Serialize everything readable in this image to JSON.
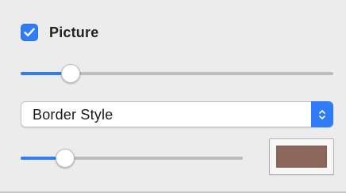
{
  "picture_toggle": {
    "label": "Picture",
    "checked": true
  },
  "picture_slider": {
    "value_fraction": 0.16
  },
  "border_style_popup": {
    "selected": "Border Style"
  },
  "border_width_slider": {
    "value_fraction": 0.2
  },
  "border_color_well": {
    "color": "#8c675c"
  },
  "colors": {
    "accent": "#2f7cf6",
    "panel": "#ececec"
  },
  "icons": {
    "checkbox": "checkmark-icon",
    "popup": "up-down-chevrons-icon"
  }
}
